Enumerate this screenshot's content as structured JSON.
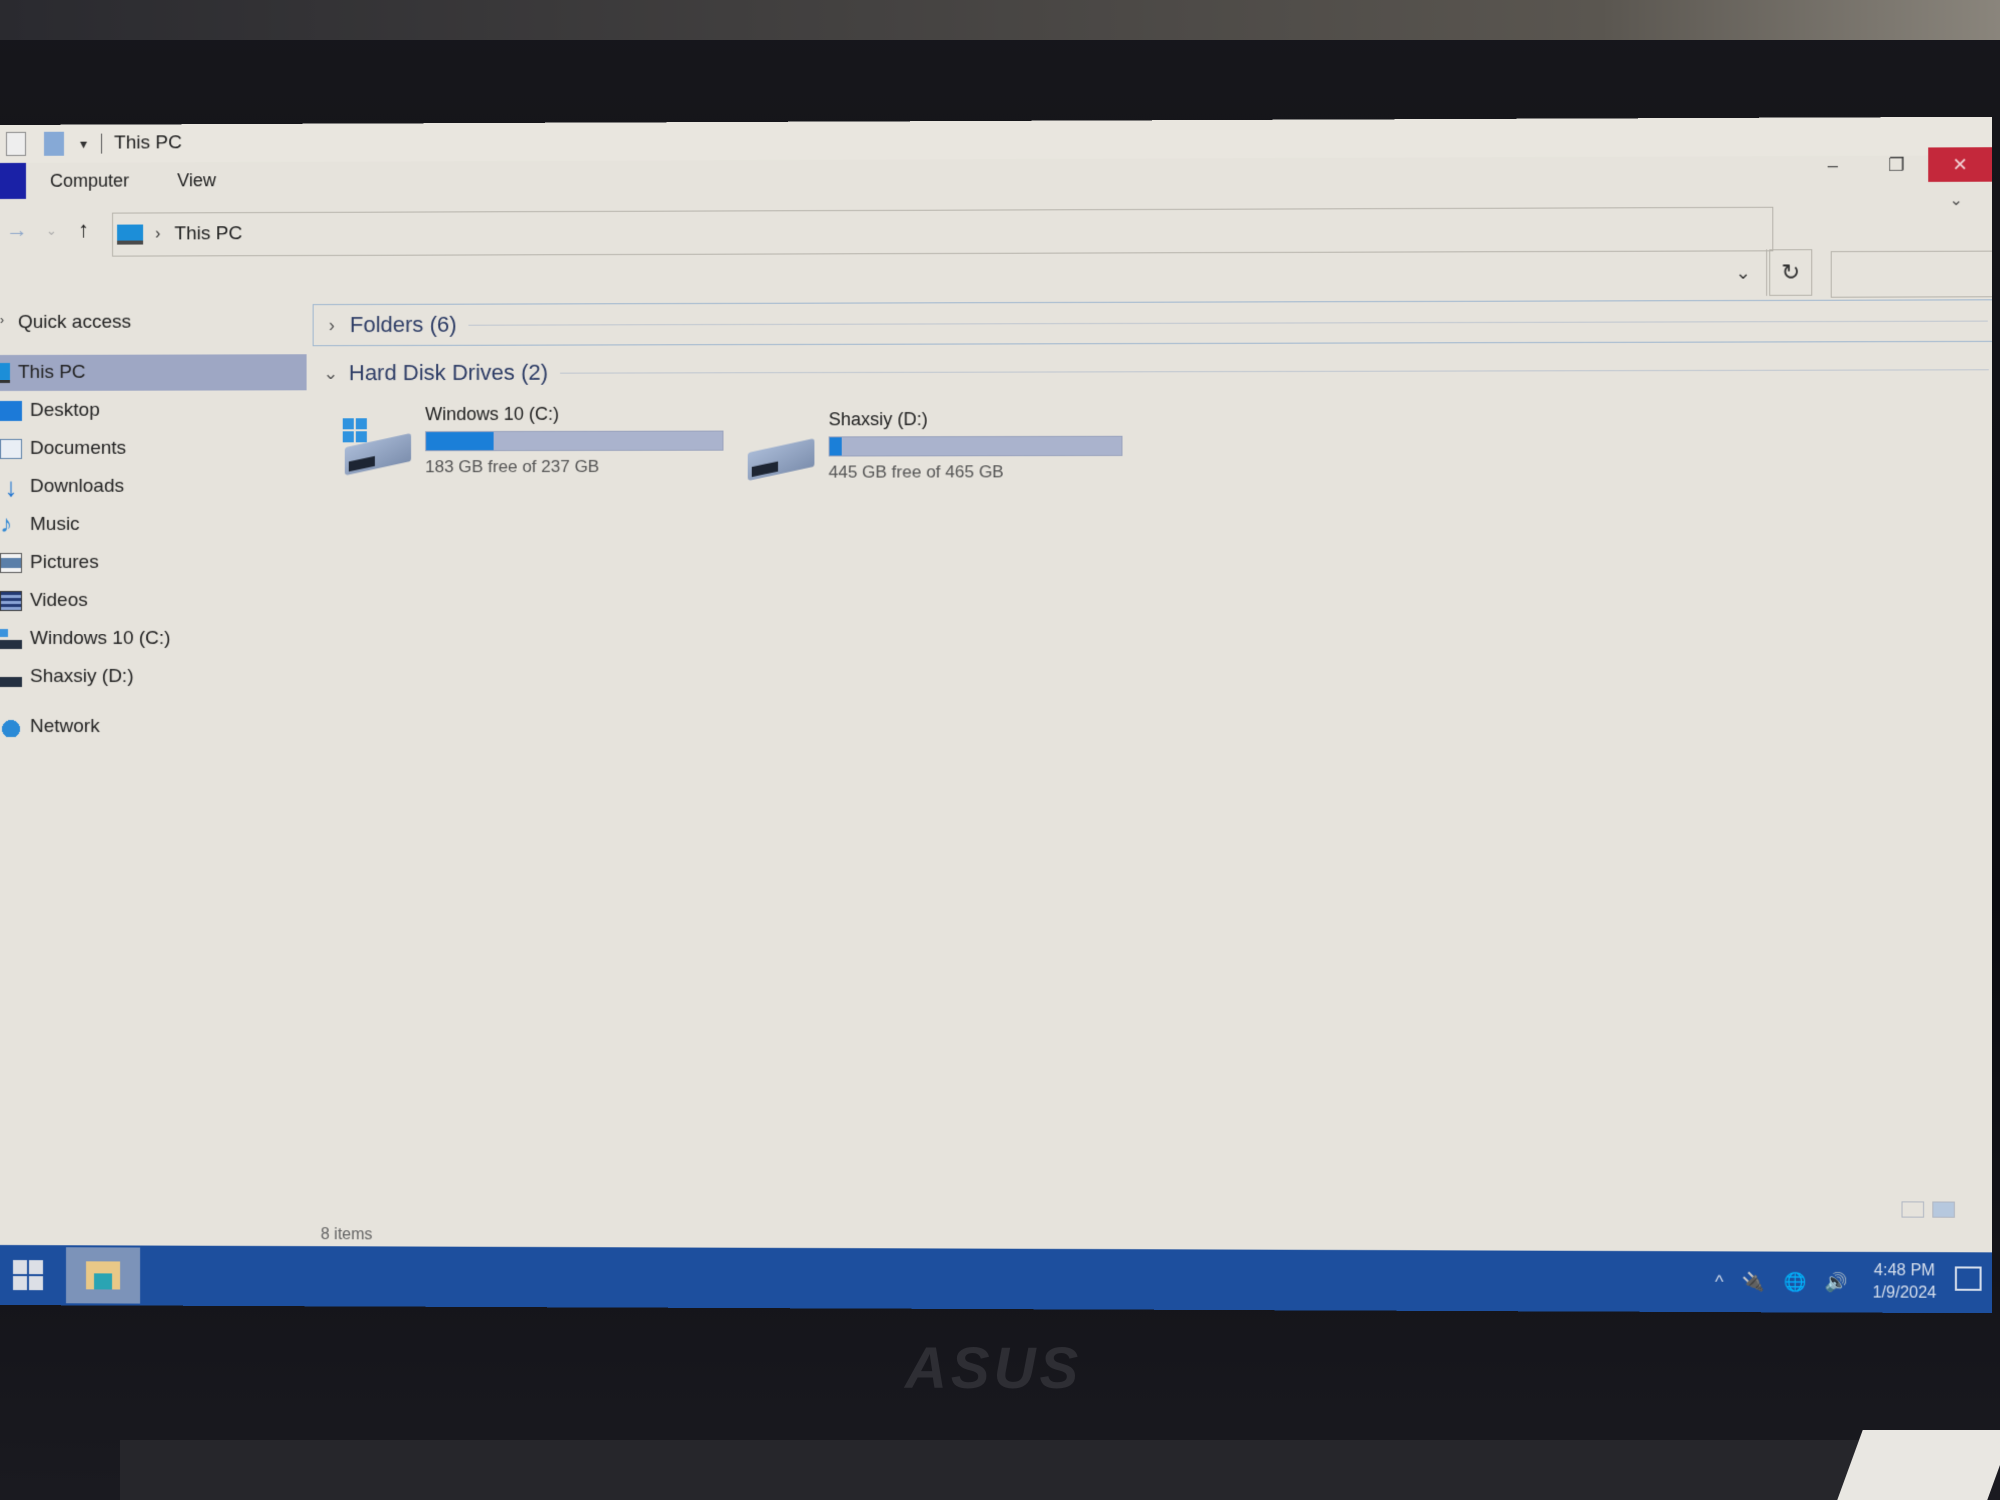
{
  "window": {
    "title": "This PC",
    "qat_dropdown_glyph": "▾",
    "controls": {
      "minimize": "–",
      "restore": "❐",
      "close": "✕"
    }
  },
  "ribbon": {
    "tabs": [
      {
        "label": "Computer"
      },
      {
        "label": "View"
      }
    ],
    "expand_glyph": "⌄"
  },
  "navigation": {
    "back_glyph": "→",
    "recent_glyph": "⌄",
    "up_glyph": "↑",
    "breadcrumb": [
      {
        "label": "This PC"
      }
    ],
    "breadcrumb_sep": "›",
    "address_dropdown_glyph": "⌄",
    "refresh_glyph": "↻",
    "search_placeholder": "",
    "search_glyph": "⚲"
  },
  "sidebar": {
    "items": [
      {
        "label": "Quick access",
        "icon": "chevron-icon",
        "glyph": "›"
      },
      {
        "label": "This PC",
        "icon": "pc-icon",
        "selected": true
      },
      {
        "label": "Desktop",
        "icon": "desktop-icon"
      },
      {
        "label": "Documents",
        "icon": "documents-icon"
      },
      {
        "label": "Downloads",
        "icon": "downloads-icon",
        "glyph": "↓"
      },
      {
        "label": "Music",
        "icon": "music-icon",
        "glyph": "♪"
      },
      {
        "label": "Pictures",
        "icon": "pictures-icon"
      },
      {
        "label": "Videos",
        "icon": "videos-icon"
      },
      {
        "label": "Windows 10 (C:)",
        "icon": "drive-c-icon"
      },
      {
        "label": "Shaxsiy (D:)",
        "icon": "drive-d-icon"
      },
      {
        "label": "Network",
        "icon": "network-icon"
      }
    ]
  },
  "content": {
    "groups": [
      {
        "label": "Folders (6)",
        "expanded": false,
        "chevron": "›"
      },
      {
        "label": "Hard Disk Drives (2)",
        "expanded": true,
        "chevron": "⌄"
      }
    ],
    "drives": [
      {
        "name": "Windows 10 (C:)",
        "free_text": "183 GB free of 237 GB",
        "free_gb": 183,
        "total_gb": 237,
        "used_fraction": 0.228,
        "has_windows_logo": true
      },
      {
        "name": "Shaxsiy (D:)",
        "free_text": "445 GB free of 465 GB",
        "free_gb": 445,
        "total_gb": 465,
        "used_fraction": 0.043,
        "has_windows_logo": false
      }
    ],
    "status": "8 items"
  },
  "taskbar": {
    "tray": {
      "overflow_glyph": "^",
      "power_glyph": "🔌",
      "network_glyph": "🌐",
      "volume_glyph": "🔊"
    },
    "time": "4:48 PM",
    "date": "1/9/2024"
  },
  "device": {
    "brand": "ASUS"
  },
  "colors": {
    "accent": "#1b7fd8",
    "selection": "#9ea7c4",
    "taskbar": "#1d4f9e",
    "close": "#c4283b",
    "file_tab": "#1a21a6"
  }
}
